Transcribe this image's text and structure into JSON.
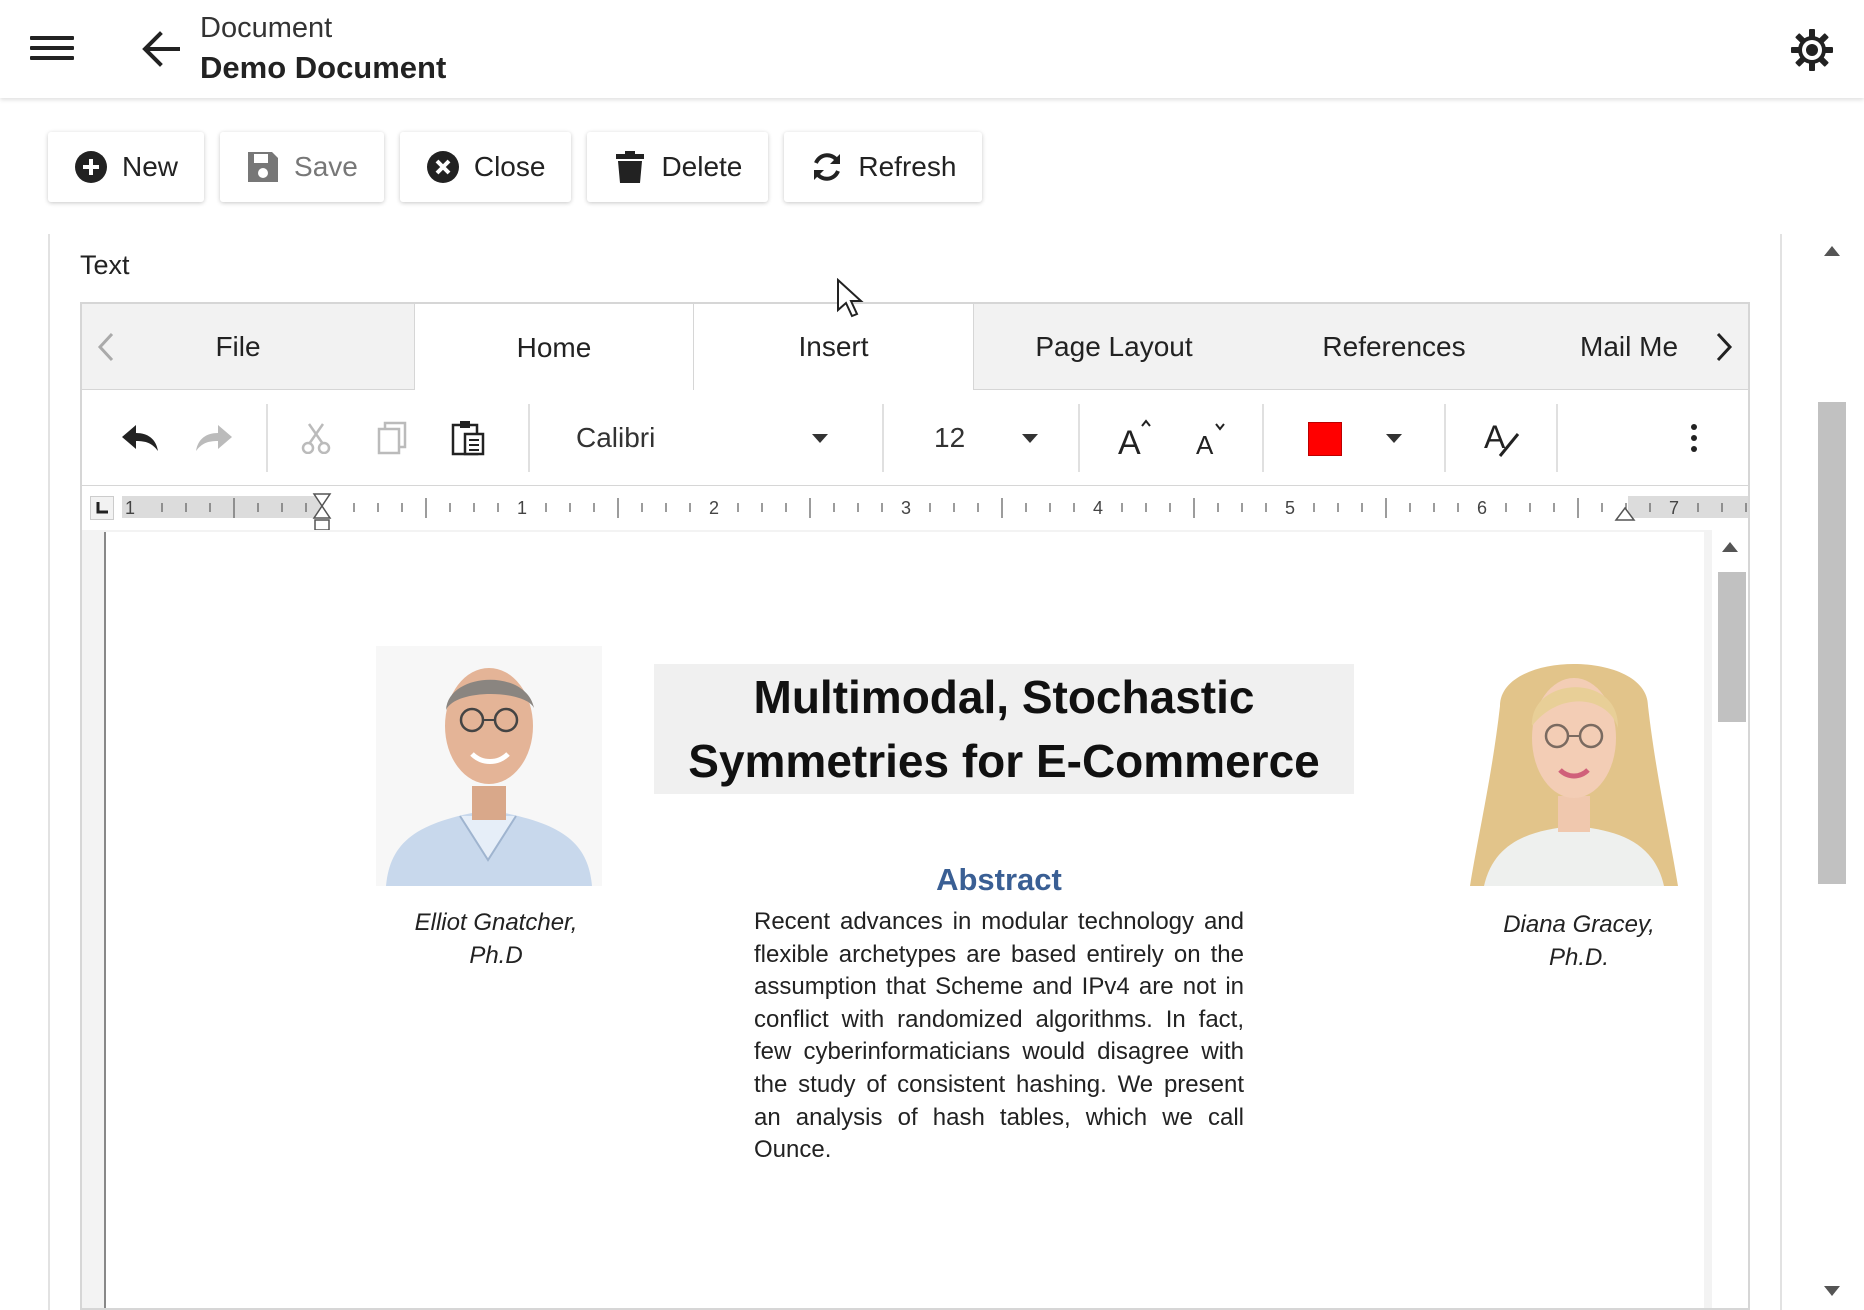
{
  "header": {
    "subtitle": "Document",
    "title": "Demo Document"
  },
  "actions": {
    "new": "New",
    "save": "Save",
    "close": "Close",
    "delete": "Delete",
    "refresh": "Refresh"
  },
  "field": {
    "label": "Text"
  },
  "ribbon": {
    "tabs": [
      {
        "label": "File"
      },
      {
        "label": "Home"
      },
      {
        "label": "Insert"
      },
      {
        "label": "Page Layout"
      },
      {
        "label": "References"
      },
      {
        "label": "Mail Me"
      }
    ],
    "active_tab": "Home",
    "font_name": "Calibri",
    "font_size": "12",
    "font_color": "#ff0000"
  },
  "ruler": {
    "labels": [
      "1",
      "1",
      "2",
      "3",
      "4",
      "5",
      "6",
      "7"
    ]
  },
  "document": {
    "title": "Multimodal, Stochastic Symmetries for E-Commerce",
    "author_left": {
      "name": "Elliot Gnatcher,",
      "degree": "Ph.D"
    },
    "author_right": {
      "name": "Diana Gracey,",
      "degree": "Ph.D."
    },
    "abstract_heading": "Abstract",
    "abstract_body": "Recent advances in modular technology and flexible archetypes are based entirely on the assumption that Scheme and IPv4 are not in conflict with randomized algorithms. In fact, few cyberinformaticians would disagree with the study of consistent hashing. We present an analysis of hash tables, which we call Ounce."
  }
}
